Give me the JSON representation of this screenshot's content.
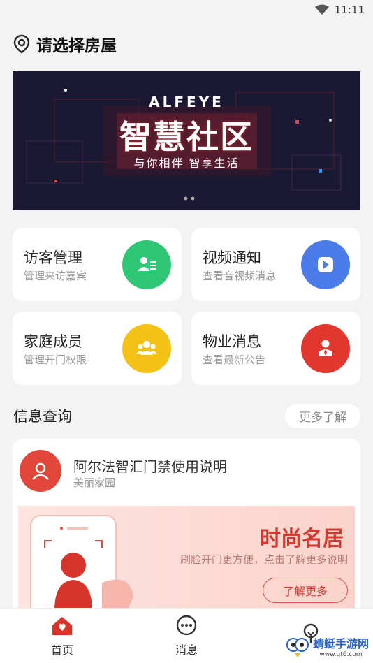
{
  "status_bar": {
    "time": "11:11"
  },
  "header": {
    "title": "请选择房屋"
  },
  "banner": {
    "brand": "ALFEYE",
    "headline": "智慧社区",
    "tagline": "与你相伴 智享生活"
  },
  "features": [
    {
      "title": "访客管理",
      "subtitle": "管理来访嘉宾",
      "color": "#2fc675"
    },
    {
      "title": "视频通知",
      "subtitle": "查看音视频消息",
      "color": "#4a7be8"
    },
    {
      "title": "家庭成员",
      "subtitle": "管理开门权限",
      "color": "#f4c216"
    },
    {
      "title": "物业消息",
      "subtitle": "查看最新公告",
      "color": "#e2372f"
    }
  ],
  "info_section": {
    "title": "信息查询",
    "more": "更多了解",
    "card": {
      "title": "阿尔法智汇门禁使用说明",
      "subtitle": "美丽家园",
      "promo_title": "时尚名居",
      "promo_sub": "刷脸开门更方便，点击了解更多说明",
      "promo_button": "了解更多"
    }
  },
  "tabs": [
    {
      "label": "首页",
      "icon": "home-icon",
      "active": true
    },
    {
      "label": "消息",
      "icon": "message-icon",
      "active": false
    },
    {
      "label": "",
      "icon": "mine-icon",
      "active": false
    }
  ],
  "watermark": {
    "text": "蜻蜓手游网",
    "url": "www.qt6.com"
  }
}
